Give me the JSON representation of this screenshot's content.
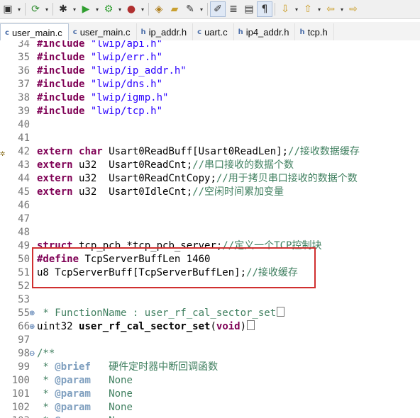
{
  "toolbar": {
    "icons": [
      "new-icon",
      "dropdown-icon",
      "refresh-icon",
      "dropdown-icon",
      "debug-icon",
      "dropdown-icon",
      "run-icon",
      "dropdown-icon",
      "external-tools-icon",
      "dropdown-icon",
      "run-config-icon",
      "dropdown-icon",
      "open-type-icon",
      "open-folder-icon",
      "brush-icon",
      "dropdown-icon",
      "pen-icon",
      "mark-icon",
      "toggle-icon",
      "pilcrow-icon",
      "next-annotation-icon",
      "dropdown-icon",
      "prev-annotation-icon",
      "dropdown-icon",
      "back-icon",
      "dropdown-icon",
      "forward-icon"
    ]
  },
  "tabs": [
    {
      "label": "user_main.c",
      "type": "c",
      "active": true
    },
    {
      "label": "user_main.c",
      "type": "c",
      "active": false
    },
    {
      "label": "ip_addr.h",
      "type": "h",
      "active": false
    },
    {
      "label": "uart.c",
      "type": "c",
      "active": false
    },
    {
      "label": "ip4_addr.h",
      "type": "h",
      "active": false
    },
    {
      "label": "tcp.h",
      "type": "h",
      "active": false
    }
  ],
  "lines": [
    {
      "n": "34",
      "code": "#include \"lwip/api.h\""
    },
    {
      "n": "35",
      "code": "#include \"lwip/err.h\""
    },
    {
      "n": "36",
      "code": "#include \"lwip/ip_addr.h\""
    },
    {
      "n": "37",
      "code": "#include \"lwip/dns.h\""
    },
    {
      "n": "38",
      "code": "#include \"lwip/igmp.h\""
    },
    {
      "n": "39",
      "code": "#include \"lwip/tcp.h\""
    },
    {
      "n": "40",
      "code": ""
    },
    {
      "n": "41",
      "code": ""
    },
    {
      "n": "42",
      "code": "extern char Usart0ReadBuff[Usart0ReadLen];//接收数据缓存"
    },
    {
      "n": "43",
      "code": "extern u32  Usart0ReadCnt;//串口接收的数据个数"
    },
    {
      "n": "44",
      "code": "extern u32  Usart0ReadCntCopy;//用于拷贝串口接收的数据个数"
    },
    {
      "n": "45",
      "code": "extern u32  Usart0IdleCnt;//空闲时间累加变量"
    },
    {
      "n": "46",
      "code": ""
    },
    {
      "n": "47",
      "code": ""
    },
    {
      "n": "48",
      "code": ""
    },
    {
      "n": "49",
      "code": "struct tcp_pcb *tcp_pcb_server;//定义一个TCP控制块"
    },
    {
      "n": "50",
      "code": "#define TcpServerBuffLen 1460"
    },
    {
      "n": "51",
      "code": "u8 TcpServerBuff[TcpServerBuffLen];//接收缓存"
    },
    {
      "n": "52",
      "code": ""
    },
    {
      "n": "53",
      "code": ""
    },
    {
      "n": "55",
      "code": " * FunctionName : user_rf_cal_sector_set"
    },
    {
      "n": "66",
      "code": "uint32 user_rf_cal_sector_set(void)"
    },
    {
      "n": "97",
      "code": ""
    },
    {
      "n": "98",
      "code": "/**"
    },
    {
      "n": "99",
      "code": " * @brief   硬件定时器中断回调函数"
    },
    {
      "n": "100",
      "code": " * @param   None"
    },
    {
      "n": "101",
      "code": " * @param   None"
    },
    {
      "n": "102",
      "code": " * @param   None"
    },
    {
      "n": "103",
      "code": " * @param   None"
    }
  ]
}
